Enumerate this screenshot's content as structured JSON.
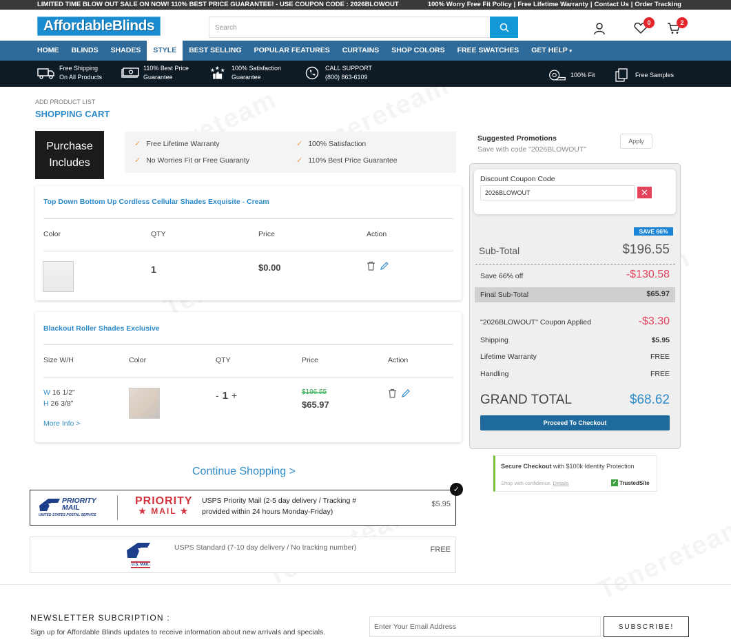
{
  "topbar": {
    "promo": "LIMITED TIME BLOW OUT SALE ON NOW! 110% BEST PRICE GUARANTEE! - USE COUPON CODE : 2026BLOWOUT",
    "links": [
      "100% Worry Free Fit Policy",
      "|",
      "Free Lifetime Warranty",
      "|",
      "Contact Us",
      "|",
      "Order Tracking"
    ]
  },
  "header": {
    "logo": "AffordableBlinds",
    "search_placeholder": "Search",
    "wishlist_count": "0",
    "cart_count": "2"
  },
  "nav": [
    "HOME",
    "BLINDS",
    "SHADES",
    "STYLE",
    "BEST SELLING",
    "POPULAR FEATURES",
    "CURTAINS",
    "SHOP COLORS",
    "FREE SWATCHES",
    "GET HELP"
  ],
  "nav_active": "STYLE",
  "features": {
    "shipping": [
      "Free Shipping",
      "On All Products"
    ],
    "price": [
      "110% Best Price",
      "Guarantee"
    ],
    "satisfaction": [
      "100% Satisfaction",
      "Guarantee"
    ],
    "support": [
      "CALL SUPPORT",
      "(800) 863-6109"
    ],
    "fit": "100% Fit",
    "samples": "Free Samples"
  },
  "cart": {
    "crumb": "ADD PRODUCT LIST",
    "title": "SHOPPING CART",
    "purchase_includes": [
      "Purchase",
      "Includes"
    ],
    "includes": [
      "Free Lifetime Warranty",
      "100% Satisfaction",
      "No Worries Fit or Free Guaranty",
      "110% Best Price Guarantee"
    ],
    "item1": {
      "name": "Top Down Bottom Up Cordless Cellular Shades Exquisite - Cream",
      "headers": [
        "Color",
        "QTY",
        "Price",
        "Action"
      ],
      "qty": "1",
      "price": "$0.00"
    },
    "item2": {
      "name": "Blackout Roller Shades Exclusive",
      "headers": [
        "Size W/H",
        "Color",
        "QTY",
        "Price",
        "Action"
      ],
      "w_label": "W",
      "w_value": "16 1/2\"",
      "h_label": "H",
      "h_value": "26 3/8\"",
      "more_info": "More Info >",
      "qty_minus": "-",
      "qty": "1",
      "qty_plus": "+",
      "old_price": "$196.55",
      "price": "$65.97"
    },
    "continue": "Continue Shopping >"
  },
  "shipping": {
    "priority": {
      "logo_line1": "PRIORITY",
      "logo_line2": "MAIL",
      "logo_sub": "UNITED STATES POSTAL SERVICE",
      "big_line1": "PRIORITY",
      "big_line2": "★ MAIL ★",
      "text": "USPS Priority Mail (2-5 day delivery / Tracking # provided within 24 hours Monday-Friday)",
      "price": "$5.95"
    },
    "standard": {
      "logo_text": "U.S. MAIL",
      "text": "USPS Standard (7-10 day delivery / No tracking number)",
      "price": "FREE"
    }
  },
  "summary": {
    "promo_title": "Suggested Promotions",
    "promo_sub": "Save with code \"2026BLOWOUT\"",
    "apply": "Apply",
    "coupon_label": "Discount Coupon Code",
    "coupon_value": "2026BLOWOUT",
    "save_badge": "SAVE 66%",
    "subtotal_label": "Sub-Total",
    "subtotal": "$196.55",
    "save_label": "Save 66% off",
    "save_value": "-$130.58",
    "final_label": "Final Sub-Total",
    "final_value": "$65.97",
    "coupon_applied_label": "\"2026BLOWOUT\" Coupon Applied",
    "coupon_applied_value": "-$3.30",
    "shipping_label": "Shipping",
    "shipping_value": "$5.95",
    "warranty_label": "Lifetime Warranty",
    "warranty_value": "FREE",
    "handling_label": "Handling",
    "handling_value": "FREE",
    "grand_label": "GRAND TOTAL",
    "grand_value": "$68.62",
    "checkout": "Proceed To Checkout",
    "secure_bold": "Secure Checkout",
    "secure_rest": " with $100k Identity Protection",
    "secure_small": "Shop with confidence.",
    "details": "Details",
    "trusted": "TrustedSite"
  },
  "newsletter": {
    "title": "NEWSLETTER SUBCRIPTION :",
    "sub": "Sign up for Affordable Blinds updates to receive information about new arrivals and specials.",
    "placeholder": "Enter Your Email Address",
    "button": "SUBSCRIBE!"
  },
  "colors": {
    "nav": "#2e6b9a",
    "accent": "#2e8bc7",
    "red": "#e2445c",
    "dark": "#0e1a24"
  }
}
